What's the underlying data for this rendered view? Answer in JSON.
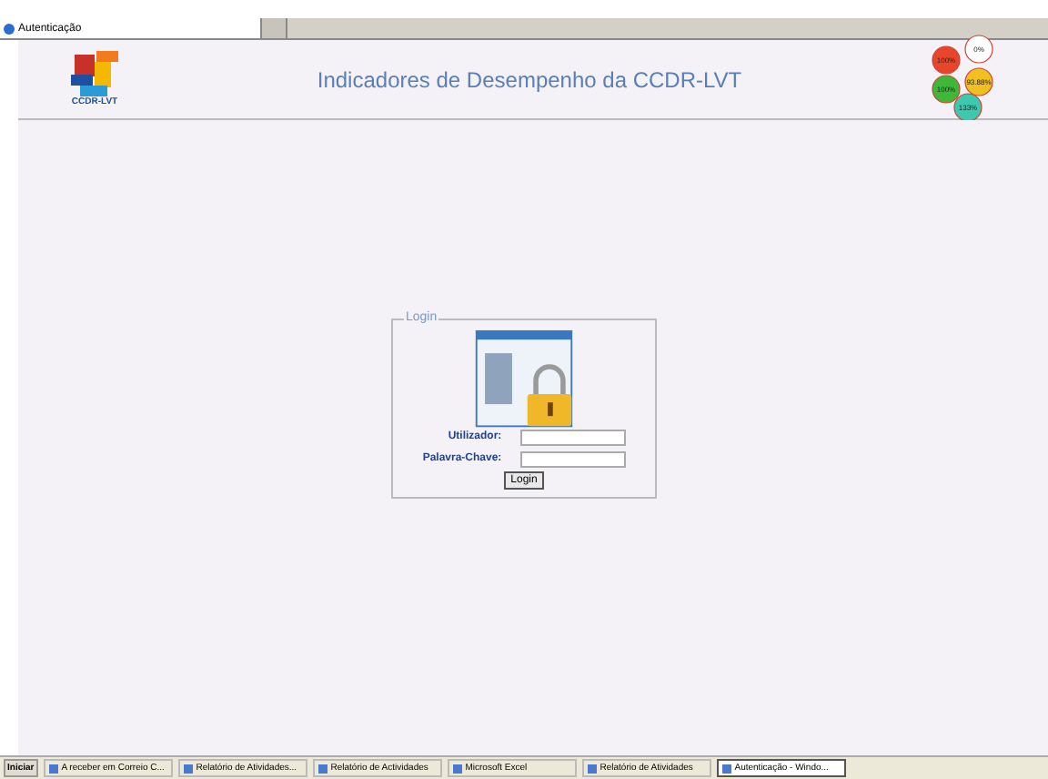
{
  "browser_tab": {
    "title": "Autenticação"
  },
  "header": {
    "title": "Indicadores de Desempenho da CCDR-LVT",
    "logo_caption": "CCDR-LVT",
    "badges": [
      {
        "label": "0%",
        "color": "#ffffff"
      },
      {
        "label": "100%",
        "color": "#e8462a"
      },
      {
        "label": "100%",
        "color": "#3fb83a"
      },
      {
        "label": "93.88%",
        "color": "#f0c020"
      },
      {
        "label": "133%",
        "color": "#3ec8b0"
      }
    ]
  },
  "login": {
    "legend": "Login",
    "fields": [
      {
        "label": "Utilizador:"
      },
      {
        "label": "Palavra-Chave:"
      }
    ],
    "button": "Login"
  },
  "taskbar": {
    "start": "Iniciar",
    "items": [
      {
        "label": "A receber em Correio C...",
        "selected": false
      },
      {
        "label": "Relatório de Atividades...",
        "selected": false
      },
      {
        "label": "Relatório de Actividades",
        "selected": false
      },
      {
        "label": "Microsoft Excel",
        "selected": false
      },
      {
        "label": "Relatório de Atividades",
        "selected": false
      },
      {
        "label": "Autenticação - Windo...",
        "selected": true
      }
    ]
  }
}
